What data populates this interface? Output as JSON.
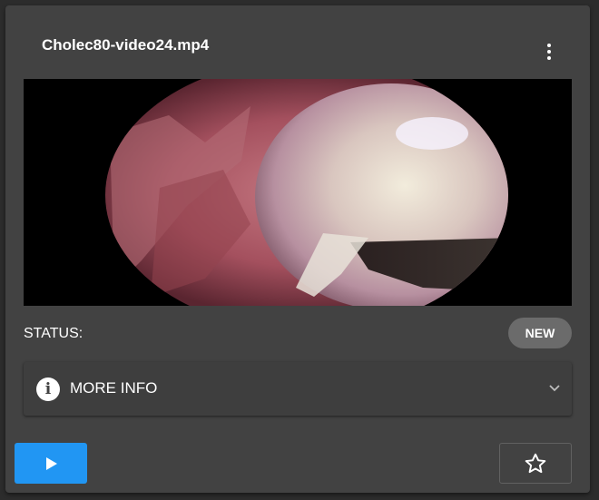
{
  "card": {
    "title": "Cholec80-video24.mp4",
    "menu_icon": "dots-vertical-icon"
  },
  "thumbnail": {
    "alt": "surgical video thumbnail"
  },
  "status": {
    "label": "STATUS:",
    "value": "NEW"
  },
  "more_info": {
    "icon": "information-icon",
    "label": "MORE INFO",
    "chevron_icon": "chevron-down-icon"
  },
  "actions": {
    "play_icon": "play-icon",
    "favorite_icon": "star-outline-icon"
  },
  "colors": {
    "card_bg": "#424242",
    "page_bg": "#2c2c2c",
    "primary": "#2196f3",
    "badge_bg": "#6b6b6b"
  }
}
